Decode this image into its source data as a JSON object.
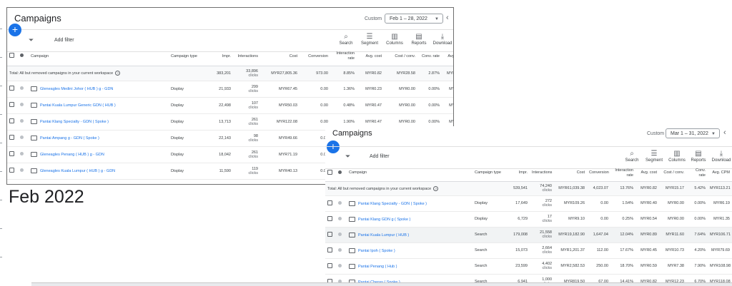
{
  "caption": "Feb 2022",
  "panel_feb": {
    "title": "Campaigns",
    "custom_label": "Custom",
    "date_range": "Feb 1 – 28, 2022",
    "toolbar": {
      "add_filter": "Add filter",
      "search": "Search",
      "segment": "Segment",
      "columns": "Columns",
      "reports": "Reports",
      "download": "Download"
    },
    "columns": [
      "Campaign",
      "Campaign type",
      "Impr.",
      "Interactions",
      "Cost",
      "Conversion",
      "Interaction rate",
      "Avg. cost",
      "Cost / conv.",
      "Conv. rate",
      "Avg. CPM"
    ],
    "total": {
      "label": "Total: All but removed campaigns in your current workspace",
      "impr": "383,201",
      "inter": "33,896",
      "inter_sub": "clicks",
      "cost": "MYR27,805.36",
      "conv": "973.00",
      "rate": "8.85%",
      "avgcost": "MYR0.82",
      "costconv": "MYR28.58",
      "convrate": "2.87%",
      "cpm": "MYR72.56"
    },
    "rows": [
      {
        "name": "Gleneagles Medini Johor ( HUB ) g - GDN",
        "type": "Display",
        "impr": "21,933",
        "inter": "299",
        "inter_sub": "clicks",
        "cost": "MYR67.45",
        "conv": "0.00",
        "rate": "1.36%",
        "avgcost": "MYR0.23",
        "costconv": "MYR0.00",
        "convrate": "0.00%",
        "cpm": "MYR3.08"
      },
      {
        "name": "Pantai Kuala Lumpur Generic GDN ( HUB )",
        "type": "Display",
        "impr": "22,498",
        "inter": "107",
        "inter_sub": "clicks",
        "cost": "MYR50.03",
        "conv": "0.00",
        "rate": "0.48%",
        "avgcost": "MYR0.47",
        "costconv": "MYR0.00",
        "convrate": "0.00%",
        "cpm": "MYR2.22"
      },
      {
        "name": "Pantai Klang Specialty - GDN ( Spoke )",
        "type": "Display",
        "impr": "13,713",
        "inter": "261",
        "inter_sub": "clicks",
        "cost": "MYR122.08",
        "conv": "0.00",
        "rate": "1.90%",
        "avgcost": "MYR0.47",
        "costconv": "MYR0.00",
        "convrate": "0.00%",
        "cpm": "MYR8.90"
      },
      {
        "name": "Pantai Ampang g - GDN ( Spoke )",
        "type": "Display",
        "impr": "22,143",
        "inter": "98",
        "inter_sub": "clicks",
        "cost": "MYR49.66",
        "conv": "0.00",
        "rate": "",
        "avgcost": "",
        "costconv": "",
        "convrate": "",
        "cpm": ""
      },
      {
        "name": "Gleneagles Penang ( HUB ) g - GDN",
        "type": "Display",
        "impr": "18,042",
        "inter": "261",
        "inter_sub": "clicks",
        "cost": "MYR71.19",
        "conv": "0.00",
        "rate": "",
        "avgcost": "",
        "costconv": "",
        "convrate": "",
        "cpm": ""
      },
      {
        "name": "Gleneagles Kuala Lumpur ( HUB ) g - GDN",
        "type": "Display",
        "impr": "11,590",
        "inter": "119",
        "inter_sub": "clicks",
        "cost": "MYR40.13",
        "conv": "0.00",
        "rate": "",
        "avgcost": "",
        "costconv": "",
        "convrate": "",
        "cpm": ""
      }
    ]
  },
  "panel_mar": {
    "title": "Campaigns",
    "custom_label": "Custom",
    "date_range": "Mar 1 – 31, 2022",
    "toolbar": {
      "add_filter": "Add filter",
      "search": "Search",
      "segment": "Segment",
      "columns": "Columns",
      "reports": "Reports",
      "download": "Download"
    },
    "columns": [
      "Campaign",
      "Campaign type",
      "Impr.",
      "Interactions",
      "Cost",
      "Conversion",
      "Interaction rate",
      "Avg. cost",
      "Cost / conv.",
      "Conv. rate",
      "Avg. CPM"
    ],
    "total": {
      "label": "Total: All but removed campaigns in your current workspace",
      "impr": "539,541",
      "inter": "74,240",
      "inter_sub": "clicks",
      "cost": "MYR61,039.38",
      "conv": "4,023.07",
      "rate": "13.76%",
      "avgcost": "MYR0.82",
      "costconv": "MYR15.17",
      "convrate": "5.42%",
      "cpm": "MYR113.21"
    },
    "rows": [
      {
        "name": "Pantai Klang Specialty - GDN ( Spoke )",
        "type": "Display",
        "impr": "17,649",
        "inter": "272",
        "inter_sub": "clicks",
        "cost": "MYR109.26",
        "conv": "0.00",
        "rate": "1.54%",
        "avgcost": "MYR0.40",
        "costconv": "MYR0.00",
        "convrate": "0.00%",
        "cpm": "MYR6.19"
      },
      {
        "name": "Pantai Klang GDN g ( Spoke )",
        "type": "Display",
        "impr": "6,729",
        "inter": "17",
        "inter_sub": "clicks",
        "cost": "MYR9.10",
        "conv": "0.00",
        "rate": "0.25%",
        "avgcost": "MYR0.54",
        "costconv": "MYR0.00",
        "convrate": "0.00%",
        "cpm": "MYR1.35"
      },
      {
        "name": "Pantai Kuala Lumpur ( HUB )",
        "type": "Search",
        "impr": "179,008",
        "inter": "21,558",
        "inter_sub": "clicks",
        "cost": "MYR19,182.90",
        "conv": "1,647.04",
        "rate": "12.04%",
        "avgcost": "MYR0.89",
        "costconv": "MYR11.60",
        "convrate": "7.64%",
        "cpm": "MYR106.71"
      },
      {
        "name": "Pantai Ipoh ( Spoke )",
        "type": "Search",
        "impr": "15,073",
        "inter": "2,664",
        "inter_sub": "clicks",
        "cost": "MYR1,201.37",
        "conv": "112.00",
        "rate": "17.67%",
        "avgcost": "MYR0.45",
        "costconv": "MYR10.73",
        "convrate": "4.20%",
        "cpm": "MYR79.69"
      },
      {
        "name": "Pantai Penang ( Hub )",
        "type": "Search",
        "impr": "23,599",
        "inter": "4,402",
        "inter_sub": "clicks",
        "cost": "MYR2,582.53",
        "conv": "250.00",
        "rate": "18.70%",
        "avgcost": "MYR0.59",
        "costconv": "MYR7.38",
        "convrate": "7.90%",
        "cpm": "MYR108.98"
      },
      {
        "name": "Pantai Cheras ( Spoke )",
        "type": "Search",
        "impr": "6,941",
        "inter": "1,000",
        "inter_sub": "clicks",
        "cost": "MYR819.50",
        "conv": "67.00",
        "rate": "14.41%",
        "avgcost": "MYR0.82",
        "costconv": "MYR12.23",
        "convrate": "6.70%",
        "cpm": "MYR118.08"
      }
    ]
  }
}
